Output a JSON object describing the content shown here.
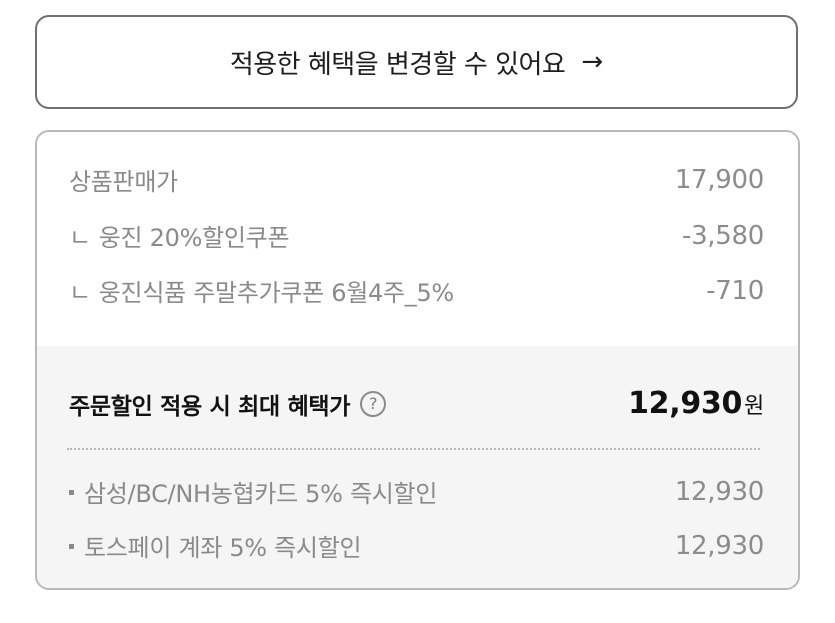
{
  "change_button": {
    "label": "적용한 혜택을 변경할 수 있어요",
    "arrow": "→"
  },
  "price_breakdown": {
    "items": [
      {
        "label": "상품판매가",
        "prefix": "",
        "value": "17,900"
      },
      {
        "label": "웅진 20%할인쿠폰",
        "prefix": "ㄴ",
        "value": "-3,580"
      },
      {
        "label": "웅진식품 주말추가쿠폰 6월4주_5%",
        "prefix": "ㄴ",
        "value": "-710"
      }
    ]
  },
  "max_benefit": {
    "label": "주문할인 적용 시 최대 혜택가",
    "help_icon": "?",
    "amount": "12,930",
    "unit": "원"
  },
  "card_discounts": [
    {
      "label": "삼성/BC/NH농협카드 5% 즉시할인",
      "value": "12,930"
    },
    {
      "label": "토스페이 계좌 5% 즉시할인",
      "value": "12,930"
    }
  ],
  "colors": {
    "border_dark": "#6f6f6f",
    "border_light": "#b9b9b9",
    "muted_text": "#8a8a8a",
    "strong_text": "#111111",
    "panel_bg": "#f5f5f5"
  }
}
